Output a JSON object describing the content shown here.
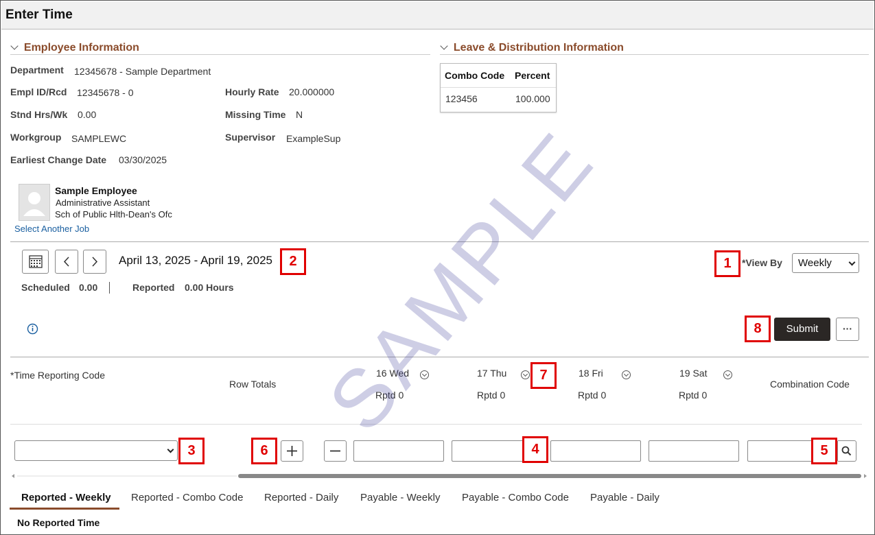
{
  "page": {
    "title": "Enter Time"
  },
  "employee_info": {
    "heading": "Employee Information",
    "department_label": "Department",
    "department_value": "12345678 - Sample Department",
    "empl_label": "Empl ID/Rcd",
    "empl_value": "12345678 - 0",
    "hourly_label": "Hourly Rate",
    "hourly_value": "20.000000",
    "stnd_label": "Stnd Hrs/Wk",
    "stnd_value": "0.00",
    "missing_label": "Missing Time",
    "missing_value": "N",
    "workgroup_label": "Workgroup",
    "workgroup_value": "SAMPLEWC",
    "supervisor_label": "Supervisor",
    "supervisor_value": "ExampleSup",
    "earliest_label": "Earliest Change Date",
    "earliest_value": "03/30/2025"
  },
  "leave_info": {
    "heading": "Leave & Distribution Information",
    "col_combo": "Combo Code",
    "col_percent": "Percent",
    "row_combo": "123456",
    "row_percent": "100.000"
  },
  "profile": {
    "name": "Sample Employee",
    "title": "Administrative Assistant",
    "dept": "Sch of Public Hlth-Dean's Ofc",
    "link": "Select Another Job"
  },
  "period": {
    "date_range": "April 13, 2025 - April 19, 2025",
    "view_by_label": "*View By",
    "view_by_value": "Weekly",
    "scheduled_label": "Scheduled",
    "scheduled_value": "0.00",
    "reported_label": "Reported",
    "reported_value": "0.00 Hours",
    "submit_label": "Submit",
    "more_label": "···"
  },
  "grid": {
    "trc_header": "*Time Reporting Code",
    "row_totals": "Row Totals",
    "combination_code": "Combination Code",
    "days": [
      {
        "day": "16 Wed",
        "rptd": "Rptd 0"
      },
      {
        "day": "17 Thu",
        "rptd": "Rptd 0"
      },
      {
        "day": "18 Fri",
        "rptd": "Rptd 0"
      },
      {
        "day": "19 Sat",
        "rptd": "Rptd 0"
      }
    ]
  },
  "callouts": [
    "1",
    "2",
    "3",
    "4",
    "5",
    "6",
    "7",
    "8"
  ],
  "tabs": [
    "Reported - Weekly",
    "Reported - Combo Code",
    "Reported - Daily",
    "Payable - Weekly",
    "Payable - Combo Code",
    "Payable - Daily"
  ],
  "no_time": "No Reported Time",
  "watermark": "SAMPLE",
  "colors": {
    "section_heading": "#8a4b2b",
    "callout": "#e00000",
    "submit_bg": "#2b2725",
    "link": "#1a5fa0",
    "active_tab_underline": "#8a4b2b"
  }
}
